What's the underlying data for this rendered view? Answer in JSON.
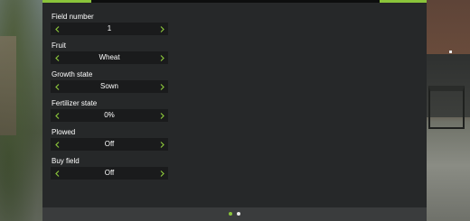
{
  "settings": [
    {
      "label": "Field number",
      "value": "1"
    },
    {
      "label": "Fruit",
      "value": "Wheat"
    },
    {
      "label": "Growth state",
      "value": "Sown"
    },
    {
      "label": "Fertilizer state",
      "value": "0%"
    },
    {
      "label": "Plowed",
      "value": "Off"
    },
    {
      "label": "Buy field",
      "value": "Off"
    }
  ],
  "pagination": {
    "pages": 2,
    "active": 1
  },
  "colors": {
    "accent": "#8ac43a",
    "panel": "#262829",
    "selector": "#1a1b1c"
  },
  "icons": {
    "prev": "chevron-left-icon",
    "next": "chevron-right-icon"
  }
}
